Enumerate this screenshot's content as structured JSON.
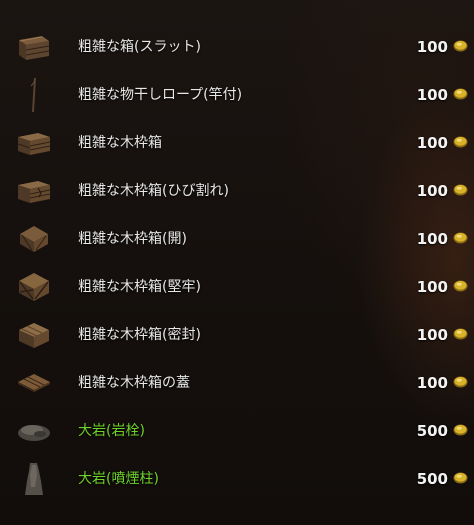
{
  "header_ghost": "",
  "colors": {
    "name_default": "#e8e8e8",
    "name_rock": "#6dd22a",
    "coin_gold": "#d8b22a"
  },
  "items": [
    {
      "name": "粗雑な箱(スラット)",
      "price": "100",
      "icon": "slatted-box-icon",
      "color": "default"
    },
    {
      "name": "粗雑な物干しロープ(竿付)",
      "price": "100",
      "icon": "clothesline-pole-icon",
      "color": "default"
    },
    {
      "name": "粗雑な木枠箱",
      "price": "100",
      "icon": "wooden-crate-icon",
      "color": "default"
    },
    {
      "name": "粗雑な木枠箱(ひび割れ)",
      "price": "100",
      "icon": "cracked-crate-icon",
      "color": "default"
    },
    {
      "name": "粗雑な木枠箱(開)",
      "price": "100",
      "icon": "open-crate-icon",
      "color": "default"
    },
    {
      "name": "粗雑な木枠箱(堅牢)",
      "price": "100",
      "icon": "sturdy-crate-icon",
      "color": "default"
    },
    {
      "name": "粗雑な木枠箱(密封)",
      "price": "100",
      "icon": "sealed-crate-icon",
      "color": "default"
    },
    {
      "name": "粗雑な木枠箱の蓋",
      "price": "100",
      "icon": "crate-lid-icon",
      "color": "default"
    },
    {
      "name": "大岩(岩栓)",
      "price": "500",
      "icon": "boulder-plug-icon",
      "color": "green"
    },
    {
      "name": "大岩(噴煙柱)",
      "price": "500",
      "icon": "smoke-pillar-rock-icon",
      "color": "green"
    },
    {
      "name": "",
      "price": "",
      "icon": "partial-item-icon",
      "color": "green"
    }
  ]
}
